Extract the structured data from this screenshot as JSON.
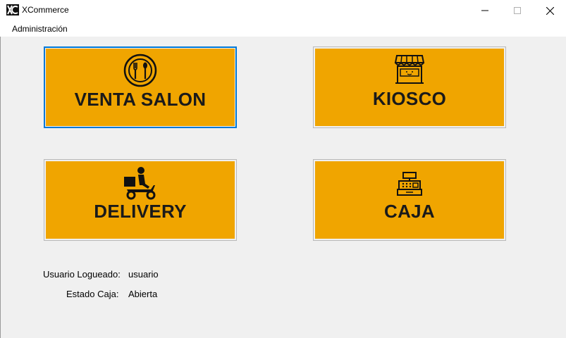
{
  "window": {
    "title": "XCommerce",
    "app_icon": "xc-logo-icon",
    "controls": [
      "minimize-icon",
      "maximize-icon",
      "close-icon"
    ]
  },
  "menu": {
    "items": [
      {
        "label": "Administración"
      }
    ]
  },
  "tiles": [
    {
      "label": "VENTA SALON",
      "icon": "cutlery-plate-icon",
      "focused": true
    },
    {
      "label": "KIOSCO",
      "icon": "storefront-icon",
      "focused": false
    },
    {
      "label": "DELIVERY",
      "icon": "delivery-scooter-icon",
      "focused": false
    },
    {
      "label": "CAJA",
      "icon": "cash-register-icon",
      "focused": false
    }
  ],
  "status": {
    "user_label": "Usuario Logueado:",
    "user_value": "usuario",
    "cash_label": "Estado Caja:",
    "cash_value": "Abierta"
  },
  "colors": {
    "tile_background": "#f0a500",
    "focus_border": "#0078d7",
    "window_background": "#f0f0f0"
  }
}
